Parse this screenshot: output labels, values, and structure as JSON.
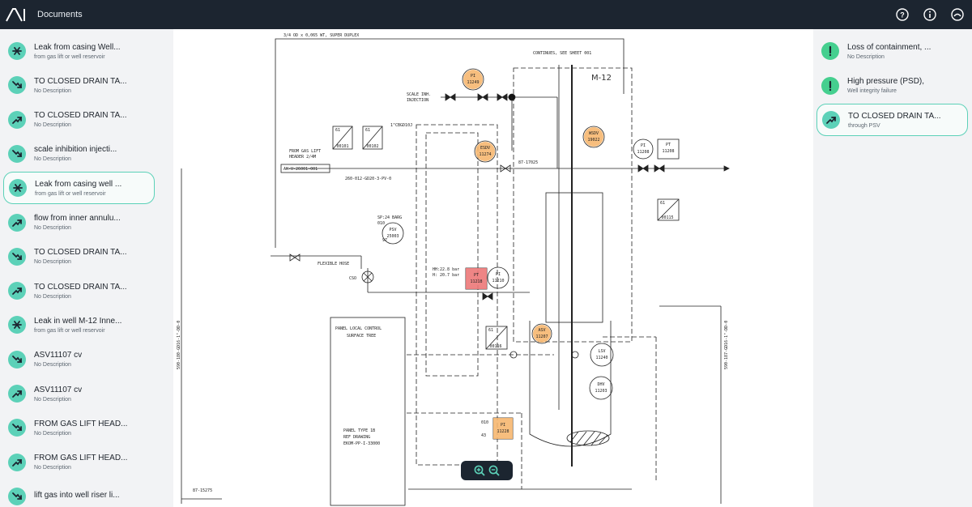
{
  "app": {
    "logo_text": "AI",
    "title": "Documents"
  },
  "top_actions": [
    {
      "name": "help-icon",
      "glyph": "?"
    },
    {
      "name": "info-icon",
      "glyph": "i"
    },
    {
      "name": "profile-icon",
      "glyph": "◠"
    }
  ],
  "left_items": [
    {
      "title": "Leak from casing Well...",
      "sub": "from gas lift or well reservoir",
      "icon": "leak-icon"
    },
    {
      "title": "TO CLOSED DRAIN TA...",
      "sub": "No Description",
      "icon": "trend-down-icon"
    },
    {
      "title": "TO CLOSED DRAIN TA...",
      "sub": "No Description",
      "icon": "trend-up-icon"
    },
    {
      "title": "scale inhibition injecti...",
      "sub": "No Description",
      "icon": "trend-down-icon"
    },
    {
      "title": "Leak from casing well ...",
      "sub": "from gas lift or well reservoir",
      "icon": "leak-icon"
    },
    {
      "title": "flow from inner annulu...",
      "sub": "No Description",
      "icon": "trend-up-icon"
    },
    {
      "title": "TO CLOSED DRAIN TA...",
      "sub": "No Description",
      "icon": "trend-down-icon"
    },
    {
      "title": "TO CLOSED DRAIN TA...",
      "sub": "No Description",
      "icon": "trend-up-icon"
    },
    {
      "title": "Leak in well M-12 Inne...",
      "sub": "from gas lift or well reservoir",
      "icon": "leak-icon"
    },
    {
      "title": "ASV11107 cv",
      "sub": "No Description",
      "icon": "trend-down-icon"
    },
    {
      "title": "ASV11107 cv",
      "sub": "No Description",
      "icon": "trend-up-icon"
    },
    {
      "title": "FROM GAS LIFT HEAD...",
      "sub": "No Description",
      "icon": "trend-down-icon"
    },
    {
      "title": "FROM GAS LIFT HEAD...",
      "sub": "No Description",
      "icon": "trend-up-icon"
    },
    {
      "title": "lift gas into well riser li...",
      "sub": "",
      "icon": "trend-down-icon"
    }
  ],
  "right_items": [
    {
      "title": "Loss of containment, ...",
      "sub": "No Description",
      "icon": "alert-icon"
    },
    {
      "title": "High pressure (PSD),",
      "sub": "Well integrity failure",
      "icon": "alert-icon"
    },
    {
      "title": "TO CLOSED DRAIN TA...",
      "sub": "through PSV",
      "icon": "trend-up-icon"
    }
  ],
  "diagram": {
    "top_label": "3/4 OD x 0,065 WT, SUPER DUPLEX",
    "continues": "CONTINUES, SEE SHEET 001",
    "well": "M-12",
    "scale_inj_1": "SCALE INH.",
    "scale_inj_2": "INJECTION",
    "from_gas_lift_1": "FROM GAS LIFT",
    "from_gas_lift_2": "HEADER 2/4M",
    "line_tag": "AK-U-26001-001",
    "pipe_tag": "260-012-GD20-3-PV-0",
    "cbgd": "1\"CBGD10J",
    "valve_tag": "87-17025",
    "sp_1": "SP:24 BARG",
    "sp_2": "010",
    "flexible": "FLEXIBLE HOSE",
    "cso": "CSO",
    "hh": "HH:22.8 bar",
    "h": "H: 20.7 bar",
    "panel_1": "PANEL LOCAL CONTROL",
    "panel_2": "SURFACE TREE",
    "panel_type": "PANEL TYPE 1B",
    "ref_drawing": "REF DRAWING",
    "ekom": "EKOM-PP-I-33000",
    "left_pipe": "590-180-GD16-1\"-DD-0",
    "right_pipe": "590-187-GD16-1\"-DD-0",
    "bottom_tag": "87-15275",
    "instruments": [
      {
        "top": "PI",
        "bot": "11249"
      },
      {
        "top": "ESDV",
        "bot": "11274"
      },
      {
        "top": "WSDV",
        "bot": "19022"
      },
      {
        "top": "PI",
        "bot": "11208"
      },
      {
        "top": "PT",
        "bot": "11208"
      },
      {
        "top": "PSV",
        "bot": "25003"
      },
      {
        "top": "PT",
        "bot": "11218"
      },
      {
        "top": "PI",
        "bot": "11210"
      },
      {
        "top": "ASV",
        "bot": "11207"
      },
      {
        "top": "LSV",
        "bot": "11240"
      },
      {
        "top": "DHV",
        "bot": "11203"
      },
      {
        "top": "PI",
        "bot": "11228"
      }
    ],
    "box_tags": [
      {
        "top": "61",
        "bot": "00101"
      },
      {
        "top": "61",
        "bot": "00102"
      },
      {
        "top": "61",
        "bot": "00115"
      },
      {
        "top": "61",
        "bot": "00116"
      }
    ],
    "misc": {
      "d1": "43",
      "d2": "010",
      "d3": "97"
    }
  },
  "colors": {
    "accent": "#5cd1b8",
    "alert": "#45cf8f",
    "highlight_orange": "#f6b770",
    "highlight_red": "#ec7878",
    "topbar": "#1c2530"
  }
}
